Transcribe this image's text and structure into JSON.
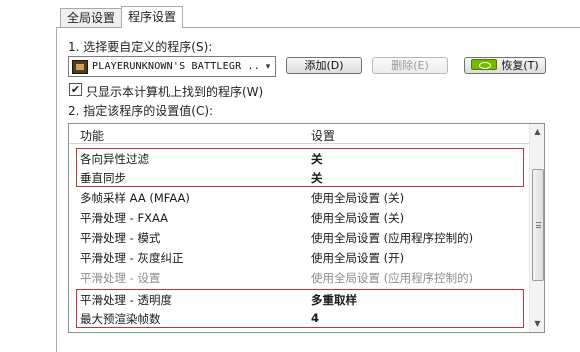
{
  "tabs": [
    {
      "label": "全局设置",
      "active": false
    },
    {
      "label": "程序设置",
      "active": true
    }
  ],
  "step1": {
    "label": "1. 选择要自定义的程序(S):",
    "program": "PLAYERUNKNOWN'S BATTLEGR ..",
    "add_label": "添加(D)",
    "remove_label": "删除(E)",
    "restore_label": "恢复(T)"
  },
  "show_only": {
    "label": "只显示本计算机上找到的程序(W)",
    "checked": true,
    "check_glyph": "✔"
  },
  "step2": {
    "label": "2. 指定该程序的设置值(C):"
  },
  "grid": {
    "headers": {
      "feature": "功能",
      "setting": "设置"
    },
    "rows": [
      {
        "feature": "各向异性过滤",
        "setting": "关",
        "bold": true,
        "gray": false
      },
      {
        "feature": "垂直同步",
        "setting": "关",
        "bold": true,
        "gray": false
      },
      {
        "feature": "多帧采样 AA (MFAA)",
        "setting": "使用全局设置 (关)",
        "bold": false,
        "gray": false
      },
      {
        "feature": "平滑处理 - FXAA",
        "setting": "使用全局设置 (关)",
        "bold": false,
        "gray": false
      },
      {
        "feature": "平滑处理 - 模式",
        "setting": "使用全局设置 (应用程序控制的)",
        "bold": false,
        "gray": false
      },
      {
        "feature": "平滑处理 - 灰度纠正",
        "setting": "使用全局设置 (开)",
        "bold": false,
        "gray": false
      },
      {
        "feature": "平滑处理 - 设置",
        "setting": "使用全局设置 (应用程序控制的)",
        "bold": false,
        "gray": true
      },
      {
        "feature": "平滑处理 - 透明度",
        "setting": "多重取样",
        "bold": true,
        "gray": false
      },
      {
        "feature": "最大预渲染帧数",
        "setting": "4",
        "bold": true,
        "gray": false
      }
    ]
  },
  "colors": {
    "highlight_border": "#c6323c",
    "nvidia_green": "#76b900"
  },
  "icons": {
    "dropdown": "▾",
    "scroll_up": "▲",
    "scroll_down": "▼"
  }
}
